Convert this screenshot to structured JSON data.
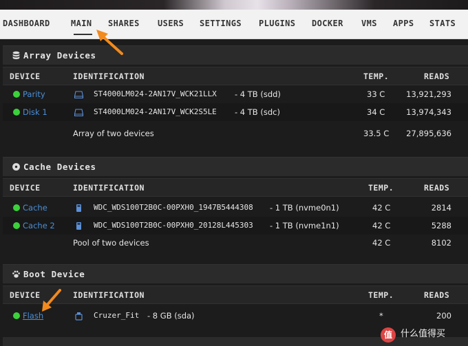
{
  "nav": {
    "items": [
      "DASHBOARD",
      "MAIN",
      "SHARES",
      "USERS",
      "SETTINGS",
      "PLUGINS",
      "DOCKER",
      "VMS",
      "APPS",
      "STATS"
    ],
    "active": "MAIN"
  },
  "array": {
    "title": "Array Devices",
    "headers": {
      "device": "DEVICE",
      "identification": "IDENTIFICATION",
      "temp": "TEMP.",
      "reads": "READS"
    },
    "rows": [
      {
        "device": "Parity",
        "id": "ST4000LM024-2AN17V_WCK21LLX",
        "size": "- 4 TB (sdd)",
        "temp": "33 C",
        "reads": "13,921,293"
      },
      {
        "device": "Disk 1",
        "id": "ST4000LM024-2AN17V_WCK2S5LE",
        "size": "- 4 TB (sdc)",
        "temp": "34 C",
        "reads": "13,974,343"
      }
    ],
    "summary": {
      "label": "Array of two devices",
      "temp": "33.5 C",
      "reads": "27,895,636"
    }
  },
  "cache": {
    "title": "Cache Devices",
    "headers": {
      "device": "DEVICE",
      "identification": "IDENTIFICATION",
      "temp": "TEMP.",
      "reads": "READS"
    },
    "rows": [
      {
        "device": "Cache",
        "id": "WDC_WDS100T2B0C-00PXH0_1947B5444308",
        "size": "- 1 TB (nvme0n1)",
        "temp": "42 C",
        "reads": "2814"
      },
      {
        "device": "Cache 2",
        "id": "WDC_WDS100T2B0C-00PXH0_20128L445303",
        "size": "- 1 TB (nvme1n1)",
        "temp": "42 C",
        "reads": "5288"
      }
    ],
    "summary": {
      "label": "Pool of two devices",
      "temp": "42 C",
      "reads": "8102"
    }
  },
  "boot": {
    "title": "Boot Device",
    "headers": {
      "device": "DEVICE",
      "identification": "IDENTIFICATION",
      "temp": "TEMP.",
      "reads": "READS"
    },
    "rows": [
      {
        "device": "Flash",
        "id": "Cruzer_Fit",
        "size": "- 8 GB (sda)",
        "temp": "*",
        "reads": "200"
      }
    ]
  },
  "watermark": {
    "logo": "值",
    "text": "什么值得买"
  },
  "colors": {
    "status_online": "#3bd13b",
    "link": "#4a8fd8",
    "annotation_arrow": "#f28a1e"
  }
}
